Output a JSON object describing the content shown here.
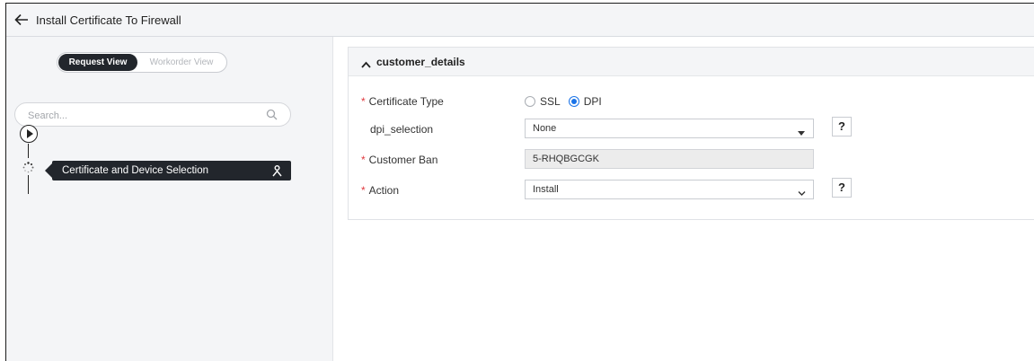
{
  "header": {
    "title": "Install Certificate To Firewall",
    "back_icon": "arrow-left-icon"
  },
  "sidebar": {
    "views": {
      "active": "Request View",
      "inactive": "Workorder View"
    },
    "search": {
      "placeholder": "Search..."
    },
    "steps": [
      {
        "label": "Certificate and Device Selection",
        "status": "in-progress"
      }
    ]
  },
  "panel": {
    "title": "customer_details",
    "fields": {
      "certificate_type": {
        "label": "Certificate Type",
        "required": "*",
        "options": [
          "SSL",
          "DPI"
        ],
        "selected": "DPI"
      },
      "dpi_selection": {
        "label": "dpi_selection",
        "value": "None",
        "help": "?"
      },
      "customer_ban": {
        "label": "Customer Ban",
        "required": "*",
        "value": "5-RHQBGCGK"
      },
      "action": {
        "label": "Action",
        "required": "*",
        "value": "Install",
        "help": "?"
      }
    }
  },
  "colors": {
    "accent": "#1a73e8",
    "dark": "#22262c",
    "required": "#e0393e"
  }
}
